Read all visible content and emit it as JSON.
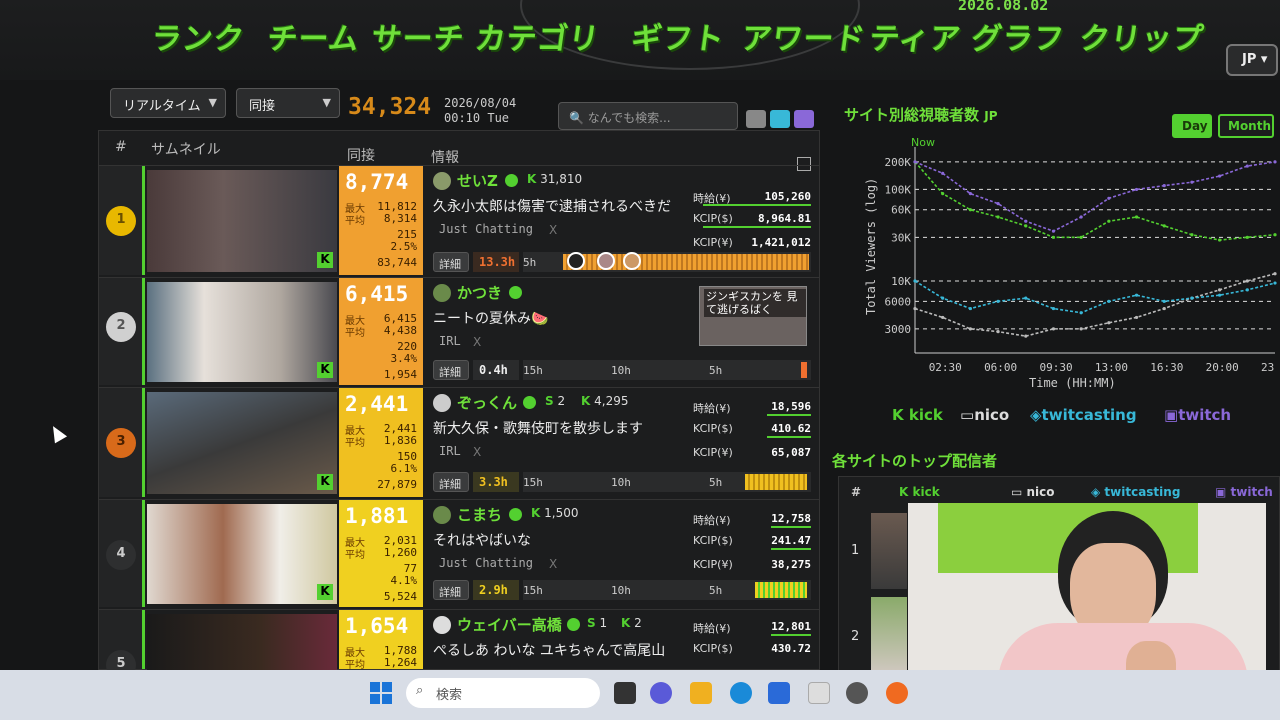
{
  "nav": {
    "items": [
      "ランク",
      "チーム",
      "サーチ",
      "カテゴリ",
      "ギフト",
      "アワード",
      "ティア",
      "グラフ",
      "クリップ"
    ],
    "date": "2026.08.02",
    "lang": "JP"
  },
  "toolbar": {
    "mode": "リアルタイム",
    "metric": "同接",
    "total_viewers": "34,324",
    "date": "2026/08/04",
    "time": "00:10 Tue",
    "search_placeholder": "なんでも検索..."
  },
  "table": {
    "headers": {
      "rank": "#",
      "thumb": "サムネイル",
      "viewers": "同接",
      "info": "情報"
    },
    "stat_labels": {
      "max": "最大",
      "avg": "平均"
    },
    "detail_label": "詳細",
    "rows": [
      {
        "rank": "1",
        "viewers": "8,774",
        "max": "11,812",
        "avg": "8,314",
        "chat": "215",
        "pct": "2.5%",
        "followers": "83,744",
        "name": "せいZ",
        "kfollow": "31,810",
        "title": "久永小太郎は傷害で逮捕されるべきだ",
        "category": "Just Chatting",
        "duration": "13.3h",
        "tl_labels": [
          "5h"
        ],
        "money": [
          [
            "時給(¥)",
            "105,260"
          ],
          [
            "KCIP($)",
            "8,964.81"
          ],
          [
            "KCIP(¥)",
            "1,421,012"
          ]
        ]
      },
      {
        "rank": "2",
        "viewers": "6,415",
        "max": "6,415",
        "avg": "4,438",
        "chat": "220",
        "pct": "3.4%",
        "followers": "1,954",
        "name": "かつき",
        "kfollow": "",
        "title": "ニートの夏休み🍉",
        "category": "IRL",
        "duration": "0.4h",
        "tl_labels": [
          "15h",
          "10h",
          "5h"
        ],
        "preview_text": "ジンギスカンを 見て逃げるばく"
      },
      {
        "rank": "3",
        "viewers": "2,441",
        "max": "2,441",
        "avg": "1,836",
        "chat": "150",
        "pct": "6.1%",
        "followers": "27,879",
        "name": "ぞっくん",
        "sfollow": "2",
        "kfollow": "4,295",
        "title": "新大久保・歌舞伎町を散歩します",
        "category": "IRL",
        "duration": "3.3h",
        "tl_labels": [
          "15h",
          "10h",
          "5h"
        ],
        "money": [
          [
            "時給(¥)",
            "18,596"
          ],
          [
            "KCIP($)",
            "410.62"
          ],
          [
            "KCIP(¥)",
            "65,087"
          ]
        ]
      },
      {
        "rank": "4",
        "viewers": "1,881",
        "max": "2,031",
        "avg": "1,260",
        "chat": "77",
        "pct": "4.1%",
        "followers": "5,524",
        "name": "こまち",
        "kfollow": "1,500",
        "title": "それはやばいな",
        "category": "Just Chatting",
        "duration": "2.9h",
        "tl_labels": [
          "15h",
          "10h",
          "5h"
        ],
        "money": [
          [
            "時給(¥)",
            "12,758"
          ],
          [
            "KCIP($)",
            "241.47"
          ],
          [
            "KCIP(¥)",
            "38,275"
          ]
        ]
      },
      {
        "rank": "5",
        "viewers": "1,654",
        "max": "1,788",
        "avg": "1,264",
        "name": "ウェイバー高橋",
        "sfollow": "1",
        "kfollow": "2",
        "title": "ぺるしあ わいな ユキちゃんで高尾山",
        "money": [
          [
            "時給(¥)",
            "12,801"
          ],
          [
            "KCIP($)",
            "430.72"
          ]
        ]
      }
    ]
  },
  "chart": {
    "title": "サイト別総視聴者数",
    "title_suffix": "JP",
    "range_day": "Day",
    "range_month": "Month",
    "now_label": "Now",
    "ylabel": "Total Viewers (log)",
    "xlabel": "Time (HH:MM)",
    "yticks": [
      "200K",
      "100K",
      "60K",
      "30K",
      "10K",
      "6000",
      "3000"
    ],
    "xticks": [
      "02:30",
      "06:00",
      "09:30",
      "13:00",
      "16:30",
      "20:00",
      "23"
    ]
  },
  "chart_data": {
    "type": "line",
    "title": "",
    "xlabel": "Time (HH:MM)",
    "ylabel": "Total Viewers (log)",
    "y_scale": "log",
    "x": [
      "00:10",
      "02:30",
      "04:00",
      "06:00",
      "07:30",
      "09:30",
      "11:00",
      "13:00",
      "14:30",
      "16:30",
      "18:00",
      "20:00",
      "22:00",
      "23:30"
    ],
    "series": [
      {
        "name": "kick",
        "color": "#53d030",
        "values": [
          200000,
          90000,
          60000,
          50000,
          40000,
          30000,
          30000,
          45000,
          50000,
          40000,
          32000,
          28000,
          30000,
          32000
        ]
      },
      {
        "name": "nico",
        "color": "#bbbbbb",
        "values": [
          5000,
          4000,
          3000,
          2800,
          2500,
          3000,
          3000,
          3500,
          4000,
          5000,
          6500,
          8000,
          10000,
          12000
        ]
      },
      {
        "name": "twitcasting",
        "color": "#38b8d8",
        "values": [
          10000,
          6500,
          5000,
          6000,
          6500,
          5000,
          4500,
          6000,
          7000,
          6000,
          6500,
          7000,
          8000,
          9500
        ]
      },
      {
        "name": "twitch",
        "color": "#8a68d8",
        "values": [
          200000,
          150000,
          90000,
          70000,
          45000,
          35000,
          50000,
          80000,
          100000,
          110000,
          120000,
          140000,
          180000,
          200000
        ]
      }
    ]
  },
  "legend": [
    "kick",
    "nico",
    "twitcasting",
    "twitch"
  ],
  "top": {
    "title": "各サイトのトップ配信者",
    "headers": [
      "#",
      "kick",
      "nico",
      "twitcasting",
      "twitch"
    ],
    "ranks": [
      "1",
      "2"
    ]
  },
  "taskbar": {
    "search_label": "検索"
  }
}
